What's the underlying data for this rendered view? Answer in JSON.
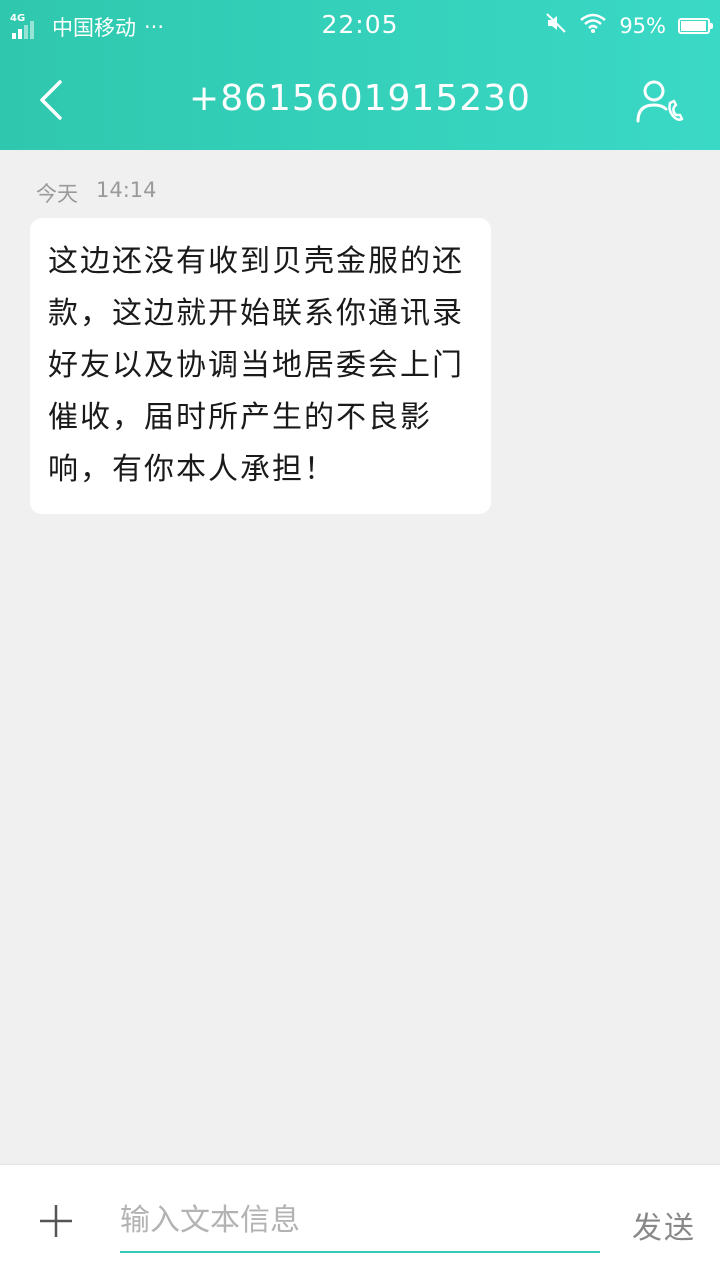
{
  "status_bar": {
    "network": "4G",
    "carrier": "中国移动",
    "more": "···",
    "time": "22:05",
    "battery_percent_text": "95%",
    "battery_level": 0.95
  },
  "header": {
    "title": "+8615601915230",
    "back_icon": "chevron-left-icon",
    "contact_icon": "contact-phone-icon"
  },
  "conversation": {
    "date_label": "今天",
    "time_label": "14:14",
    "message_text": "这边还没有收到贝壳金服的还款，这边就开始联系你通讯录好友以及协调当地居委会上门催收，届时所产生的不良影响，有你本人承担！"
  },
  "composer": {
    "plus_label": "+",
    "placeholder": "输入文本信息",
    "send_label": "发送"
  },
  "colors": {
    "header_start": "#2fc8ae",
    "header_end": "#3ad9c6",
    "background": "#f0f0f0",
    "bubble": "#ffffff",
    "input_underline": "#35c9b6"
  }
}
